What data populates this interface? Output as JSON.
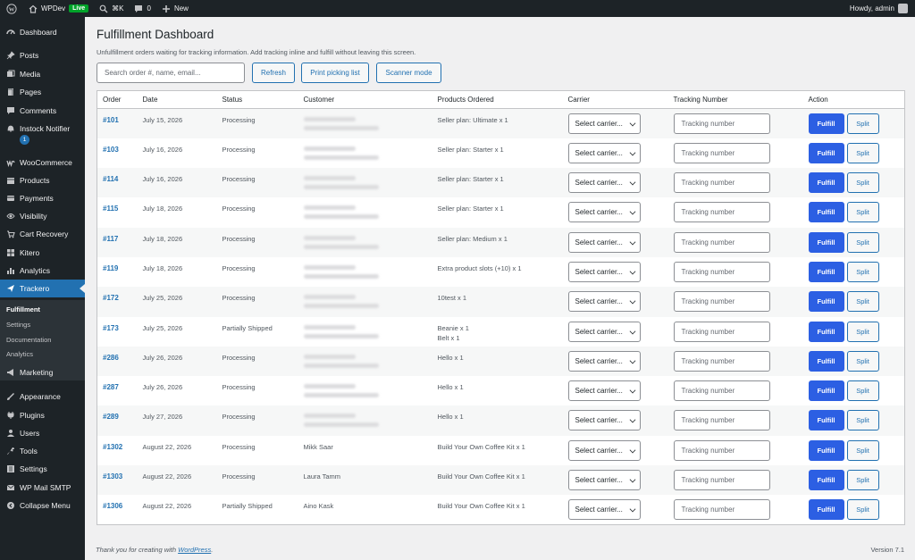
{
  "adminbar": {
    "site_name": "WPDev",
    "live_badge": "Live",
    "shortcut": "⌘K",
    "comments_count": "0",
    "new_label": "New",
    "greeting": "Howdy, admin"
  },
  "sidebar": {
    "items": [
      {
        "label": "Dashboard",
        "icon": "dashboard-icon"
      },
      {
        "label": "Posts",
        "icon": "pin-icon"
      },
      {
        "label": "Media",
        "icon": "media-icon"
      },
      {
        "label": "Pages",
        "icon": "pages-icon"
      },
      {
        "label": "Comments",
        "icon": "comment-icon"
      },
      {
        "label": "Instock Notifier",
        "icon": "bell-icon"
      },
      {
        "label": "WooCommerce",
        "icon": "woo-icon"
      },
      {
        "label": "Products",
        "icon": "box-icon"
      },
      {
        "label": "Payments",
        "icon": "card-icon"
      },
      {
        "label": "Visibility",
        "icon": "eye-icon"
      },
      {
        "label": "Cart Recovery",
        "icon": "cart-icon"
      },
      {
        "label": "Kitero",
        "icon": "grid-icon"
      },
      {
        "label": "Analytics",
        "icon": "bar-chart-icon"
      },
      {
        "label": "Trackero",
        "icon": "plane-icon"
      },
      {
        "label": "Marketing",
        "icon": "megaphone-icon"
      },
      {
        "label": "Appearance",
        "icon": "brush-icon"
      },
      {
        "label": "Plugins",
        "icon": "plug-icon"
      },
      {
        "label": "Users",
        "icon": "user-icon"
      },
      {
        "label": "Tools",
        "icon": "wrench-icon"
      },
      {
        "label": "Settings",
        "icon": "settings-icon"
      },
      {
        "label": "WP Mail SMTP",
        "icon": "mail-icon"
      },
      {
        "label": "Collapse Menu",
        "icon": "collapse-icon"
      }
    ],
    "notifier_badge": "1",
    "submenu": [
      "Fulfillment",
      "Settings",
      "Documentation",
      "Analytics"
    ]
  },
  "page": {
    "title": "Fulfillment Dashboard",
    "description": "Unfulfillment orders waiting for tracking information. Add tracking inline and fulfill without leaving this screen.",
    "search_placeholder": "Search order #, name, email...",
    "refresh_label": "Refresh",
    "print_label": "Print picking list",
    "scanner_label": "Scanner mode"
  },
  "table": {
    "columns": [
      "Order",
      "Date",
      "Status",
      "Customer",
      "Products Ordered",
      "Carrier",
      "Tracking Number",
      "Action"
    ],
    "carrier_placeholder": "Select carrier...",
    "tracking_placeholder": "Tracking number",
    "fulfill_label": "Fulfill",
    "split_label": "Split",
    "rows": [
      {
        "order": "#101",
        "date": "July 15, 2026",
        "status": "Processing",
        "customer": "",
        "products": [
          "Seller plan: Ultimate x 1"
        ]
      },
      {
        "order": "#103",
        "date": "July 16, 2026",
        "status": "Processing",
        "customer": "",
        "products": [
          "Seller plan: Starter x 1"
        ]
      },
      {
        "order": "#114",
        "date": "July 16, 2026",
        "status": "Processing",
        "customer": "",
        "products": [
          "Seller plan: Starter x 1"
        ]
      },
      {
        "order": "#115",
        "date": "July 18, 2026",
        "status": "Processing",
        "customer": "",
        "products": [
          "Seller plan: Starter x 1"
        ]
      },
      {
        "order": "#117",
        "date": "July 18, 2026",
        "status": "Processing",
        "customer": "",
        "products": [
          "Seller plan: Medium x 1"
        ]
      },
      {
        "order": "#119",
        "date": "July 18, 2026",
        "status": "Processing",
        "customer": "",
        "products": [
          "Extra product slots (+10) x 1"
        ]
      },
      {
        "order": "#172",
        "date": "July 25, 2026",
        "status": "Processing",
        "customer": "",
        "products": [
          "10test x 1"
        ]
      },
      {
        "order": "#173",
        "date": "July 25, 2026",
        "status": "Partially Shipped",
        "customer": "",
        "products": [
          "Beanie x 1",
          "Belt x 1"
        ]
      },
      {
        "order": "#286",
        "date": "July 26, 2026",
        "status": "Processing",
        "customer": "",
        "products": [
          "Hello x 1"
        ]
      },
      {
        "order": "#287",
        "date": "July 26, 2026",
        "status": "Processing",
        "customer": "",
        "products": [
          "Hello x 1"
        ]
      },
      {
        "order": "#289",
        "date": "July 27, 2026",
        "status": "Processing",
        "customer": "",
        "products": [
          "Hello x 1"
        ]
      },
      {
        "order": "#1302",
        "date": "August 22, 2026",
        "status": "Processing",
        "customer": "Mikk Saar",
        "products": [
          "Build Your Own Coffee Kit x 1"
        ]
      },
      {
        "order": "#1303",
        "date": "August 22, 2026",
        "status": "Processing",
        "customer": "Laura Tamm",
        "products": [
          "Build Your Own Coffee Kit x 1"
        ]
      },
      {
        "order": "#1306",
        "date": "August 22, 2026",
        "status": "Partially Shipped",
        "customer": "Aino Kask",
        "products": [
          "Build Your Own Coffee Kit x 1"
        ]
      }
    ]
  },
  "footer": {
    "thanks_prefix": "Thank you for creating with ",
    "thanks_link": "WordPress",
    "thanks_suffix": ".",
    "version": "Version 7.1"
  }
}
